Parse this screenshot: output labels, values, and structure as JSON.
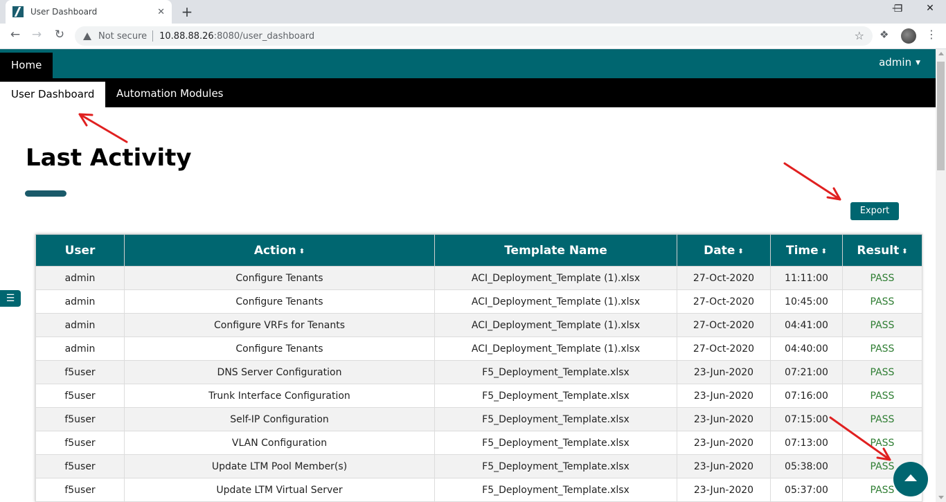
{
  "browser": {
    "tab_title": "User Dashboard",
    "tab_close": "✕",
    "new_tab": "+",
    "not_secure": "Not secure",
    "url_host": "10.88.88.26",
    "url_rest": ":8080/user_dashboard",
    "window_controls": [
      "—",
      "❐",
      "✕"
    ]
  },
  "nav": {
    "home": "Home",
    "user": "admin",
    "subtabs": [
      "User Dashboard",
      "Automation Modules"
    ]
  },
  "main": {
    "heading": "Last Activity",
    "export": "Export",
    "side_toggle": "☰"
  },
  "table": {
    "columns": [
      {
        "label": "User",
        "sortable": false
      },
      {
        "label": "Action",
        "sortable": true
      },
      {
        "label": "Template Name",
        "sortable": false
      },
      {
        "label": "Date",
        "sortable": true
      },
      {
        "label": "Time",
        "sortable": true
      },
      {
        "label": "Result",
        "sortable": true
      }
    ],
    "rows": [
      [
        "admin",
        "Configure Tenants",
        "ACI_Deployment_Template (1).xlsx",
        "27-Oct-2020",
        "11:11:00",
        "PASS"
      ],
      [
        "admin",
        "Configure Tenants",
        "ACI_Deployment_Template (1).xlsx",
        "27-Oct-2020",
        "10:45:00",
        "PASS"
      ],
      [
        "admin",
        "Configure VRFs for Tenants",
        "ACI_Deployment_Template (1).xlsx",
        "27-Oct-2020",
        "04:41:00",
        "PASS"
      ],
      [
        "admin",
        "Configure Tenants",
        "ACI_Deployment_Template (1).xlsx",
        "27-Oct-2020",
        "04:40:00",
        "PASS"
      ],
      [
        "f5user",
        "DNS Server Configuration",
        "F5_Deployment_Template.xlsx",
        "23-Jun-2020",
        "07:21:00",
        "PASS"
      ],
      [
        "f5user",
        "Trunk Interface Configuration",
        "F5_Deployment_Template.xlsx",
        "23-Jun-2020",
        "07:16:00",
        "PASS"
      ],
      [
        "f5user",
        "Self-IP Configuration",
        "F5_Deployment_Template.xlsx",
        "23-Jun-2020",
        "07:15:00",
        "PASS"
      ],
      [
        "f5user",
        "VLAN Configuration",
        "F5_Deployment_Template.xlsx",
        "23-Jun-2020",
        "07:13:00",
        "PASS"
      ],
      [
        "f5user",
        "Update LTM Pool Member(s)",
        "F5_Deployment_Template.xlsx",
        "23-Jun-2020",
        "05:38:00",
        "PASS"
      ],
      [
        "f5user",
        "Update LTM Virtual Server",
        "F5_Deployment_Template.xlsx",
        "23-Jun-2020",
        "05:37:00",
        "PASS"
      ]
    ]
  },
  "colors": {
    "primary": "#006670",
    "pass": "#2e7d32",
    "annotation": "#e02020"
  },
  "icons": [
    "warning-icon",
    "star-icon",
    "extensions-icon",
    "sort-icon",
    "menu-icon",
    "arrow-up-icon"
  ]
}
